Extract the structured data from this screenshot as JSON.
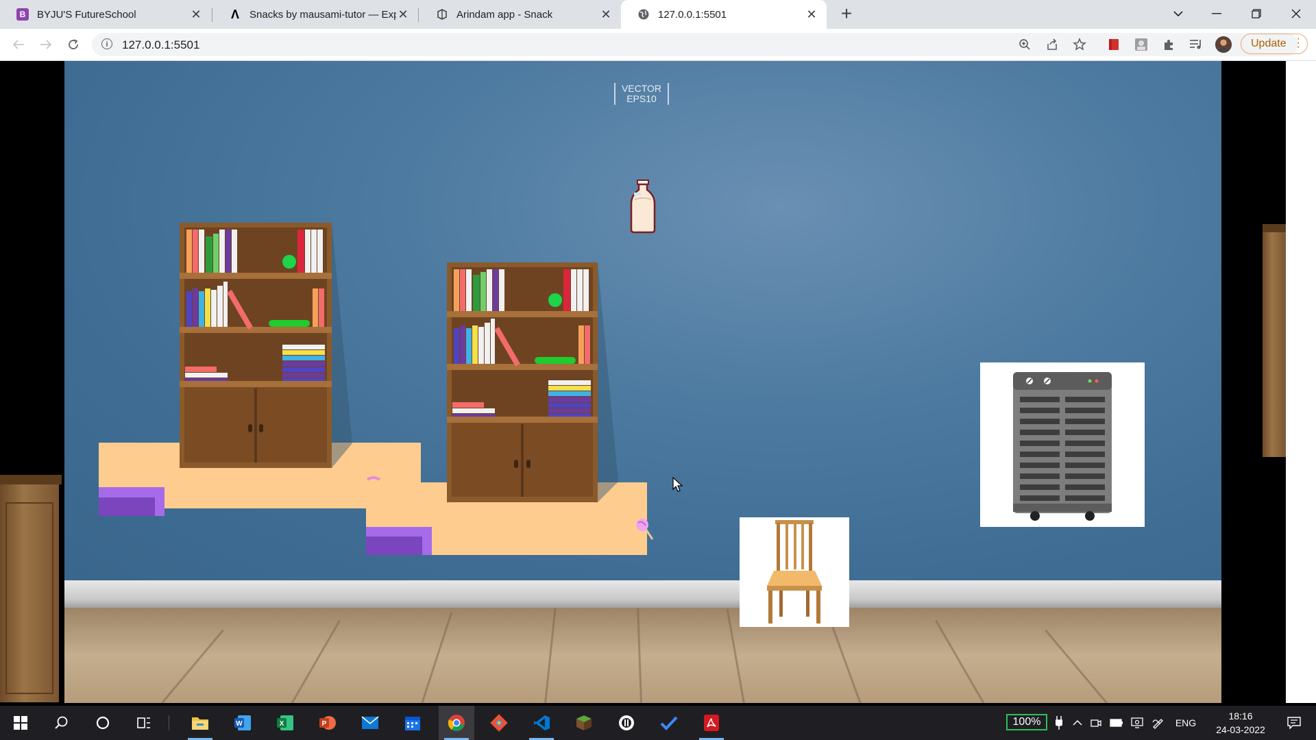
{
  "browser": {
    "tabs": [
      {
        "title": "BYJU'S FutureSchool",
        "icon": "byjus-logo-icon",
        "color": "#8e44ad"
      },
      {
        "title": "Snacks by mausami-tutor — Expo",
        "icon": "expo-logo-icon",
        "color": "#000000"
      },
      {
        "title": "Arindam app - Snack",
        "icon": "snack-logo-icon",
        "color": "#444444"
      },
      {
        "title": "127.0.0.1:5501",
        "icon": "globe-icon",
        "color": "#5f6368",
        "active": true
      }
    ],
    "new_tab_label": "+",
    "window_controls": {
      "dropdown": "⌄",
      "minimize": "—",
      "restore": "❐",
      "close": "✕"
    },
    "address": "127.0.0.1:5501",
    "update_label": "Update",
    "accent_color": "#b06000"
  },
  "scene": {
    "watermark_line1": "VECTOR",
    "watermark_line2": "EPS10",
    "wall_color": "#3d6b92",
    "platform_color": "#ffcc90",
    "block_color": "#a66be8"
  },
  "taskbar": {
    "apps": [
      "windows-start-icon",
      "search-icon",
      "cortana-icon",
      "task-view-icon",
      "file-explorer-icon",
      "word-icon",
      "excel-icon",
      "powerpoint-icon",
      "mail-icon",
      "calendar-icon",
      "chrome-icon",
      "git-icon",
      "vscode-icon",
      "minecraft-icon",
      "github-desktop-icon",
      "todo-icon",
      "acrobat-icon"
    ],
    "battery_percent": "100%",
    "language": "ENG",
    "time": "18:16",
    "date": "24-03-2022"
  }
}
